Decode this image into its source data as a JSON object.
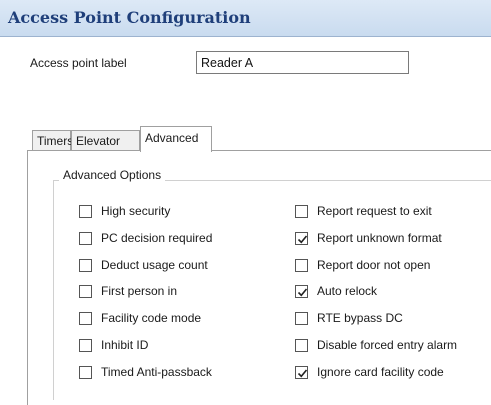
{
  "window": {
    "title": "Access Point Configuration"
  },
  "label_field": {
    "label": "Access point label",
    "value": "Reader A"
  },
  "tabs": [
    {
      "label": "Timers",
      "active": false
    },
    {
      "label": "Elevator",
      "active": false
    },
    {
      "label": "Advanced",
      "active": true
    }
  ],
  "advanced": {
    "group_title": "Advanced Options",
    "left_options": [
      {
        "label": "High security",
        "checked": false
      },
      {
        "label": "PC decision required",
        "checked": false
      },
      {
        "label": "Deduct usage count",
        "checked": false
      },
      {
        "label": "First person in",
        "checked": false
      },
      {
        "label": "Facility code mode",
        "checked": false
      },
      {
        "label": "Inhibit ID",
        "checked": false
      },
      {
        "label": "Timed Anti-passback",
        "checked": false
      }
    ],
    "right_options": [
      {
        "label": "Report request to exit",
        "checked": false
      },
      {
        "label": "Report unknown format",
        "checked": true
      },
      {
        "label": "Report door not open",
        "checked": false
      },
      {
        "label": "Auto relock",
        "checked": true
      },
      {
        "label": "RTE bypass DC",
        "checked": false
      },
      {
        "label": "Disable forced entry alarm",
        "checked": false
      },
      {
        "label": "Ignore card facility code",
        "checked": true
      }
    ]
  }
}
